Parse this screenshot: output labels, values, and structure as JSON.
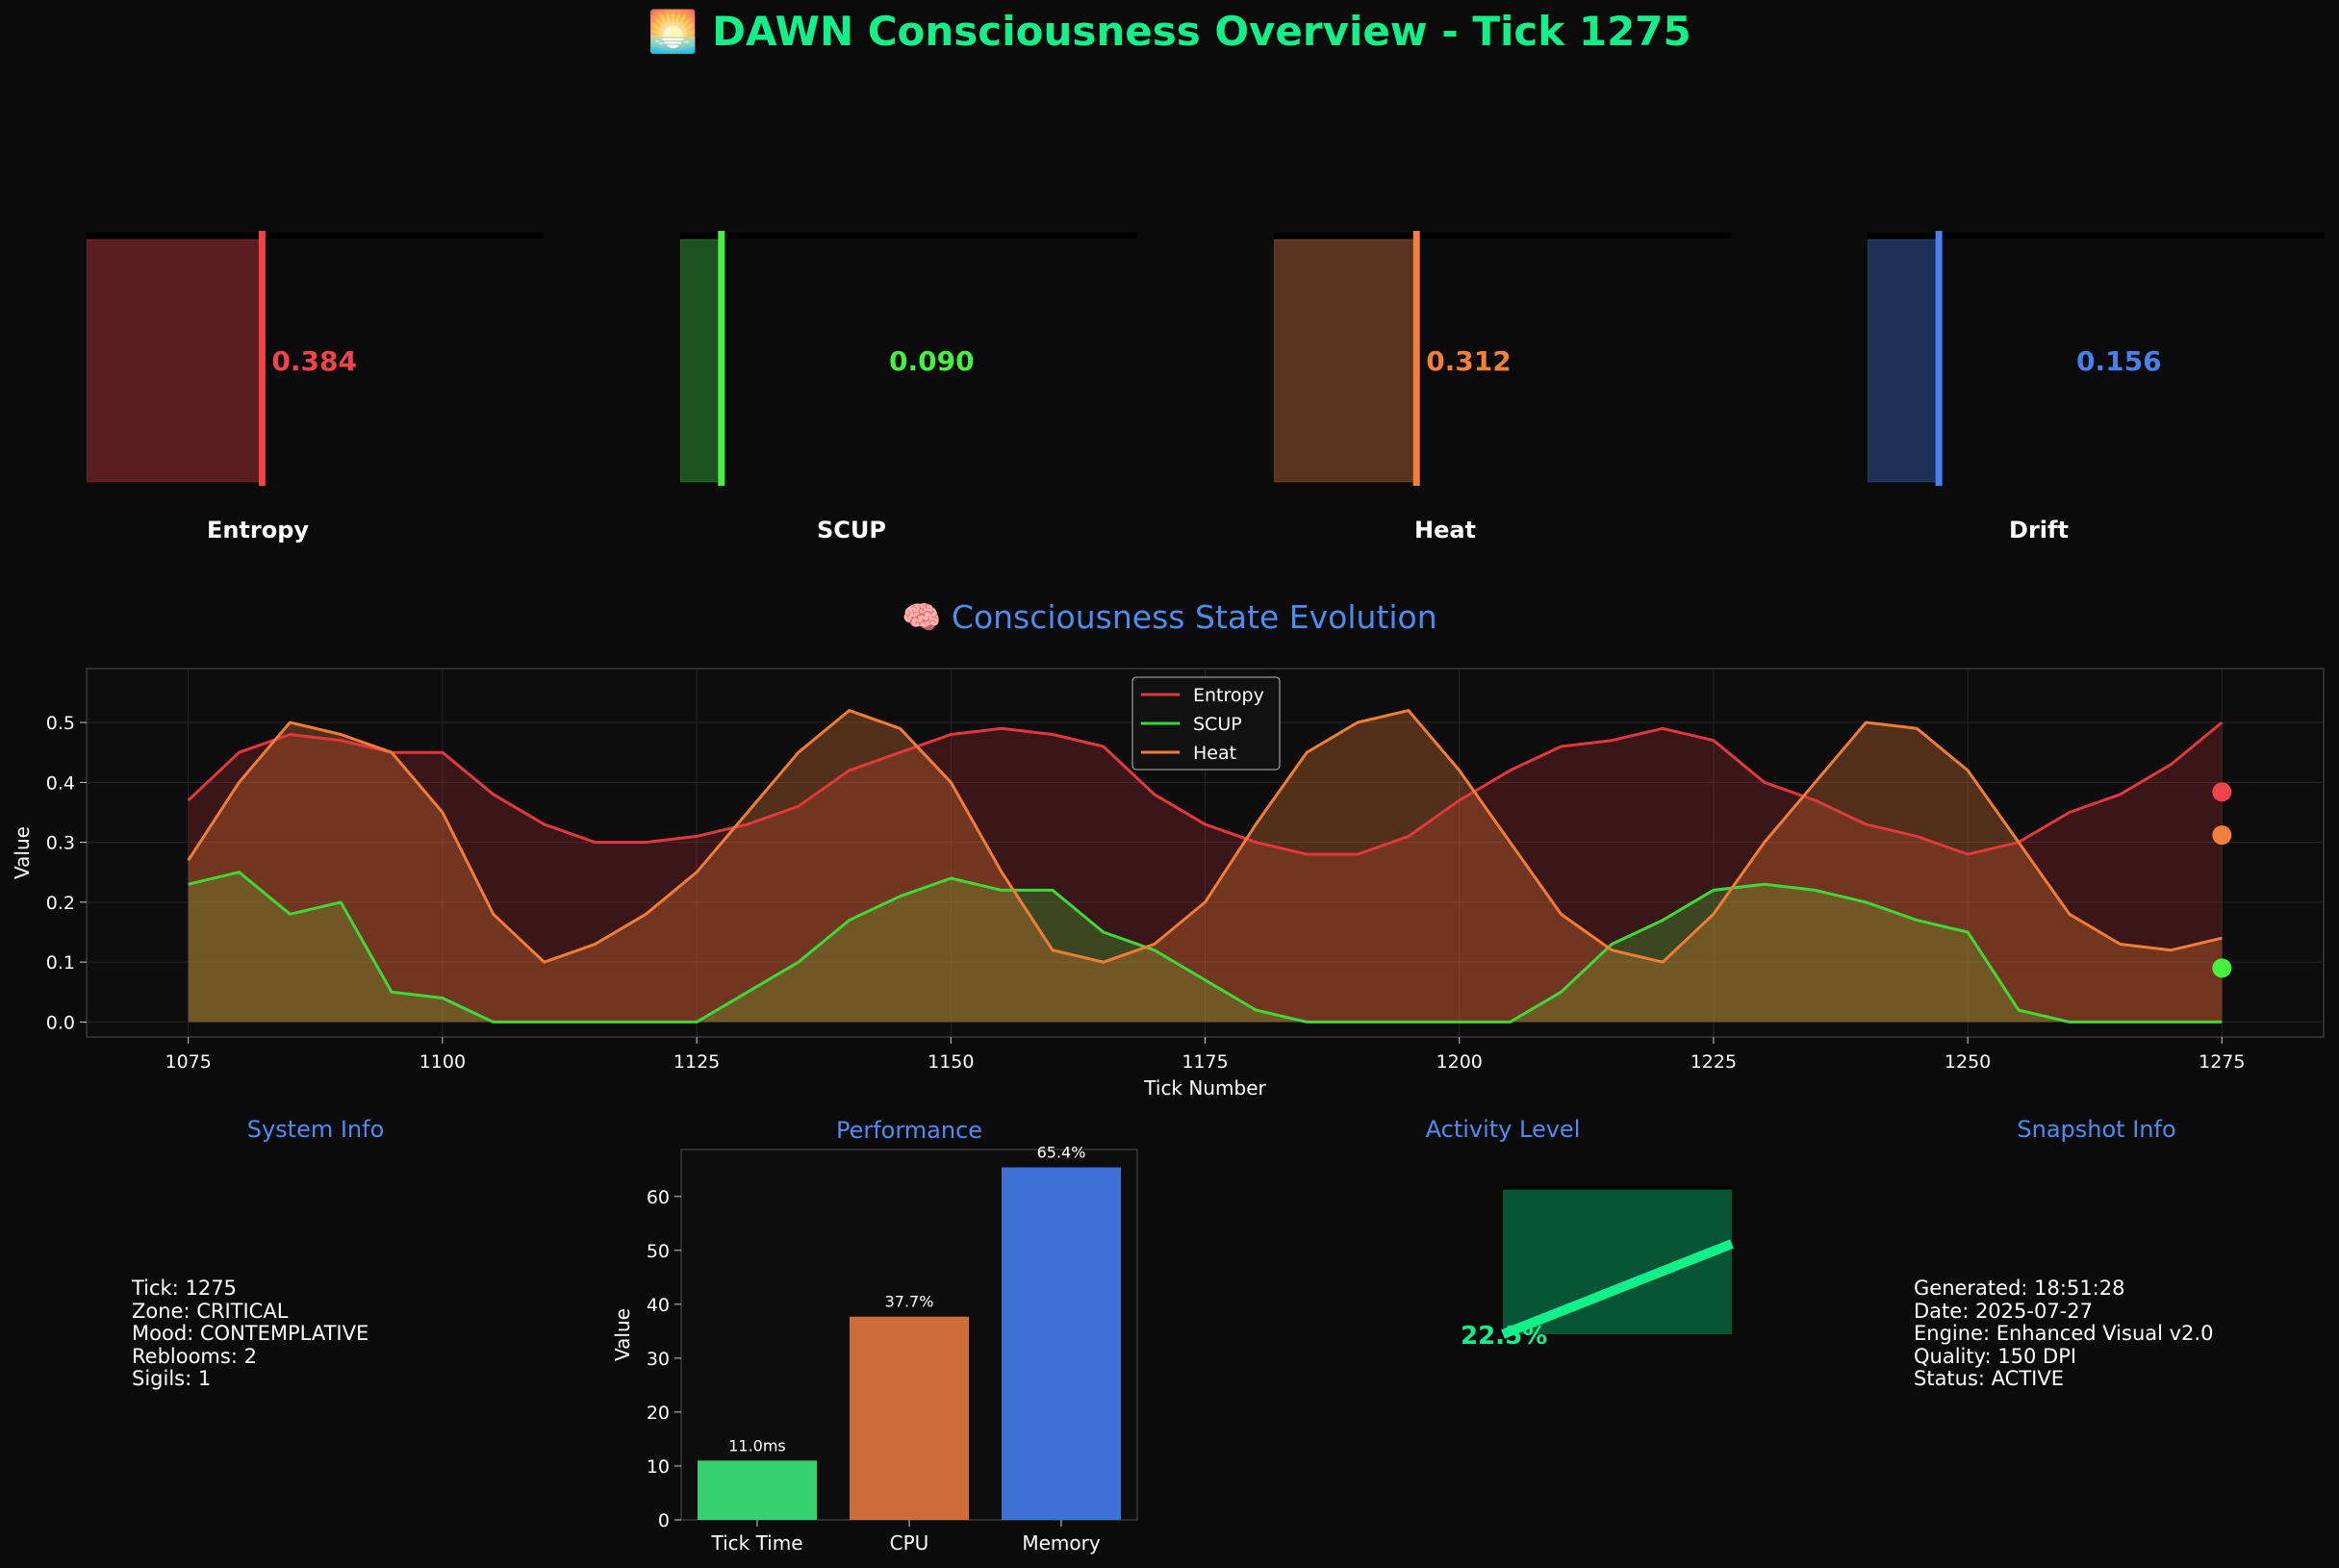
{
  "title": "🌅 DAWN Consciousness Overview - Tick 1275",
  "gauges": [
    {
      "label": "Entropy",
      "value": 0.384,
      "display": "0.384",
      "color": "#f0434a",
      "fill": "#5a1e22"
    },
    {
      "label": "SCUP",
      "value": 0.09,
      "display": "0.090",
      "color": "#45f040",
      "fill": "#1e5220"
    },
    {
      "label": "Heat",
      "value": 0.312,
      "display": "0.312",
      "color": "#f0803a",
      "fill": "#5a3420"
    },
    {
      "label": "Drift",
      "value": 0.156,
      "display": "0.156",
      "color": "#4a7ff0",
      "fill": "#1e3056"
    }
  ],
  "evolution_title": "🧠 Consciousness State Evolution",
  "panels": {
    "system_title": "System Info",
    "performance_title": "Performance",
    "activity_title": "Activity Level",
    "snapshot_title": "Snapshot Info",
    "system_lines": [
      "Tick: 1275",
      "Zone: CRITICAL",
      "Mood: CONTEMPLATIVE",
      "Reblooms: 2",
      "Sigils: 1"
    ],
    "snapshot_lines": [
      "Generated: 18:51:28",
      "Date: 2025-07-27",
      "Engine: Enhanced Visual v2.0",
      "Quality: 150 DPI",
      "Status: ACTIVE"
    ],
    "activity_value": "22.5%"
  },
  "chart_data": [
    {
      "type": "line",
      "xlabel": "Tick Number",
      "ylabel": "Value",
      "xlim": [
        1065,
        1285
      ],
      "ylim": [
        -0.025,
        0.59
      ],
      "xticks": [
        1075,
        1100,
        1125,
        1150,
        1175,
        1200,
        1225,
        1250,
        1275
      ],
      "yticks": [
        0.0,
        0.1,
        0.2,
        0.3,
        0.4,
        0.5
      ],
      "grid": true,
      "legend_position": "top-center",
      "x": [
        1075,
        1080,
        1085,
        1090,
        1095,
        1100,
        1105,
        1110,
        1115,
        1120,
        1125,
        1130,
        1135,
        1140,
        1145,
        1150,
        1155,
        1160,
        1165,
        1170,
        1175,
        1180,
        1185,
        1190,
        1195,
        1200,
        1205,
        1210,
        1215,
        1220,
        1225,
        1230,
        1235,
        1240,
        1245,
        1250,
        1255,
        1260,
        1265,
        1270,
        1275
      ],
      "series": [
        {
          "name": "Entropy",
          "color": "#e0383e",
          "values": [
            0.37,
            0.45,
            0.48,
            0.47,
            0.45,
            0.45,
            0.38,
            0.33,
            0.3,
            0.3,
            0.31,
            0.33,
            0.36,
            0.42,
            0.45,
            0.48,
            0.49,
            0.48,
            0.46,
            0.38,
            0.33,
            0.3,
            0.28,
            0.28,
            0.31,
            0.37,
            0.42,
            0.46,
            0.47,
            0.49,
            0.47,
            0.4,
            0.37,
            0.33,
            0.31,
            0.28,
            0.3,
            0.35,
            0.38,
            0.43,
            0.5
          ]
        },
        {
          "name": "SCUP",
          "color": "#3fd838",
          "values": [
            0.23,
            0.25,
            0.18,
            0.2,
            0.05,
            0.04,
            0.0,
            0.0,
            0.0,
            0.0,
            0.0,
            0.05,
            0.1,
            0.17,
            0.21,
            0.24,
            0.22,
            0.22,
            0.15,
            0.12,
            0.07,
            0.02,
            0.0,
            0.0,
            0.0,
            0.0,
            0.0,
            0.05,
            0.13,
            0.17,
            0.22,
            0.23,
            0.22,
            0.2,
            0.17,
            0.15,
            0.02,
            0.0,
            0.0,
            0.0,
            0.0
          ]
        },
        {
          "name": "Heat",
          "color": "#ef7d35",
          "values": [
            0.27,
            0.4,
            0.5,
            0.48,
            0.45,
            0.35,
            0.18,
            0.1,
            0.13,
            0.18,
            0.25,
            0.35,
            0.45,
            0.52,
            0.49,
            0.4,
            0.25,
            0.12,
            0.1,
            0.13,
            0.2,
            0.33,
            0.45,
            0.5,
            0.52,
            0.42,
            0.3,
            0.18,
            0.12,
            0.1,
            0.18,
            0.3,
            0.4,
            0.5,
            0.49,
            0.42,
            0.3,
            0.18,
            0.13,
            0.12,
            0.14
          ]
        }
      ],
      "endpoints": [
        {
          "series": "Entropy",
          "value": 0.384,
          "color": "#f0434a"
        },
        {
          "series": "Heat",
          "value": 0.312,
          "color": "#f0803a"
        },
        {
          "series": "SCUP",
          "value": 0.09,
          "color": "#45f040"
        }
      ]
    },
    {
      "type": "bar",
      "ylabel": "Value",
      "ylim": [
        0,
        68.7
      ],
      "yticks": [
        0,
        10,
        20,
        30,
        40,
        50,
        60
      ],
      "categories": [
        "Tick Time",
        "CPU",
        "Memory"
      ],
      "values": [
        11.0,
        37.7,
        65.4
      ],
      "data_labels": [
        "11.0ms",
        "37.7%",
        "65.4%"
      ],
      "colors": [
        "#34d070",
        "#cd6e3a",
        "#3c70d4"
      ]
    }
  ]
}
